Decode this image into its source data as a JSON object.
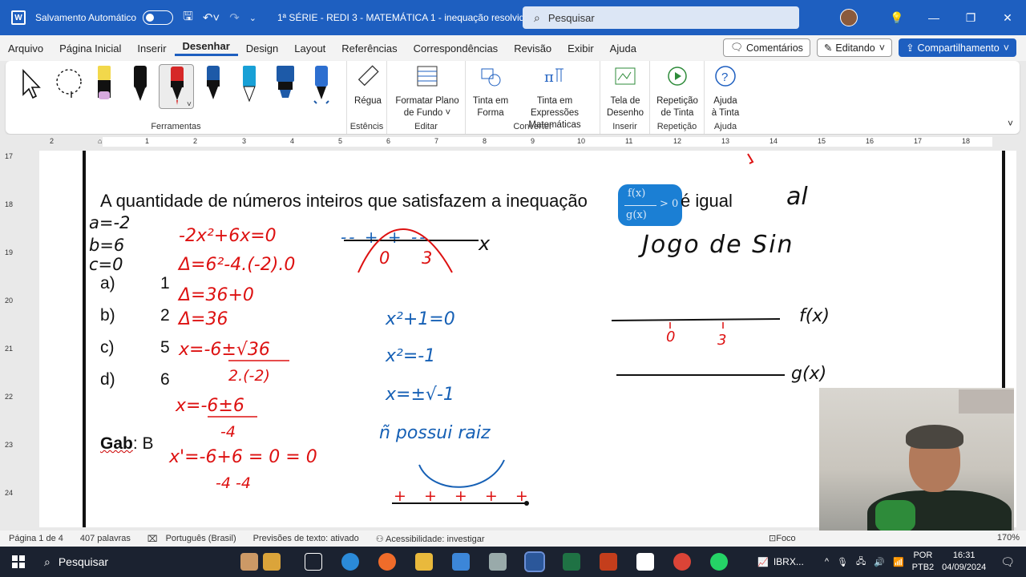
{
  "titlebar": {
    "app_letter": "W",
    "autosave_label": "Salvamento Automático",
    "doc_title": "1ª SÉRIE - REDI 3 - MATEMÁTICA 1 - inequação resolvida",
    "search_placeholder": "Pesquisar"
  },
  "menu": {
    "items": [
      "Arquivo",
      "Página Inicial",
      "Inserir",
      "Desenhar",
      "Design",
      "Layout",
      "Referências",
      "Correspondências",
      "Revisão",
      "Exibir",
      "Ajuda"
    ],
    "active": "Desenhar",
    "comments": "Comentários",
    "editing": "Editando",
    "share": "Compartilhamento"
  },
  "ribbon": {
    "groups": {
      "ferramentas": "Ferramentas",
      "estenceis": "Estêncis",
      "editar": "Editar",
      "converter": "Converter",
      "inserir": "Inserir",
      "repeticao": "Repetição",
      "ajuda": "Ajuda"
    },
    "buttons": {
      "regua": "Régua",
      "formatar_1": "Formatar Plano",
      "formatar_2": "de Fundo ˅",
      "tinta_forma_1": "Tinta em",
      "tinta_forma_2": "Forma",
      "tinta_expr_1": "Tinta em Expressões",
      "tinta_expr_2": "Matemáticas",
      "tela_1": "Tela de",
      "tela_2": "Desenho",
      "rep_1": "Repetição",
      "rep_2": "de Tinta",
      "ajuda_1": "Ajuda",
      "ajuda_2": "à Tinta"
    },
    "pen_colors": [
      "#f2d84b",
      "#111111",
      "#d62828",
      "#1d5aa8",
      "#18a0d6",
      "#1d5aa8",
      "#2d6fd0"
    ]
  },
  "ruler": {
    "ticks": [
      "2",
      "1",
      "1",
      "2",
      "3",
      "4",
      "5",
      "6",
      "7",
      "8",
      "9",
      "10",
      "11",
      "12",
      "13",
      "14",
      "15",
      "16",
      "17",
      "18"
    ],
    "vticks": [
      "17",
      "18",
      "19",
      "20",
      "21",
      "22",
      "23",
      "24"
    ]
  },
  "document": {
    "question_before": "A quantidade de números inteiros que satisfazem a inequação",
    "ineq_num": "f(x)",
    "ineq_den": "g(x)",
    "ineq_gt": "> 0",
    "question_after": "é igual",
    "options": [
      {
        "letter": "a)",
        "value": "1"
      },
      {
        "letter": "b)",
        "value": "2"
      },
      {
        "letter": "c)",
        "value": "5"
      },
      {
        "letter": "d)",
        "value": "6"
      }
    ],
    "gab_label": "Gab",
    "gab_value": ": B",
    "handwriting": {
      "coef_a": "a=-2",
      "coef_b": "b=6",
      "coef_c": "c=0",
      "eq1": "-2x²+6x=0",
      "eq2": "Δ=6²-4.(-2).0",
      "eq3": "Δ=36+0",
      "eq4": "Δ=36",
      "eq5": "x=-6±√36",
      "eq5_den": "2.(-2)",
      "eq6": "x=-6±6",
      "eq6_den": "-4",
      "eq7": "x'=-6+6 = 0 = 0",
      "eq7_den": "-4    -4",
      "roots_0": "0",
      "roots_3": "3",
      "signs_top": "-- + + --",
      "axis_x": "x",
      "blue1": "x²+1=0",
      "blue2": "x²=-1",
      "blue3": "x=±√-1",
      "blue4": "ñ possui raiz",
      "blue_signs": "+ + + + +",
      "black_al": "al",
      "black_jogo": "Jogo de Sin",
      "fx_label": "f(x)",
      "gx_label": "g(x)",
      "line_0": "0",
      "line_3": "3"
    }
  },
  "statusbar": {
    "page": "Página 1 de 4",
    "words": "407 palavras",
    "lang": "Português (Brasil)",
    "pred": "Previsões de texto: ativado",
    "acc": "Acessibilidade: investigar",
    "focus": "Foco",
    "zoom": "170%"
  },
  "taskbar": {
    "search": "Pesquisar",
    "ticker": "IBRX...",
    "lang1": "POR",
    "lang2": "PTB2",
    "time": "16:31",
    "date": "04/09/2024"
  }
}
